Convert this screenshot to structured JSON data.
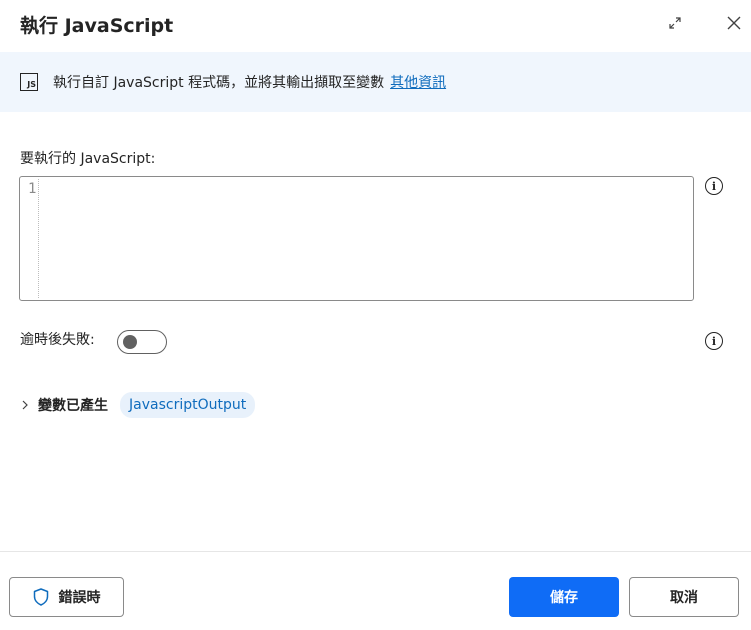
{
  "dialog": {
    "title": "執行 JavaScript",
    "expand_icon": "expand-icon",
    "close_icon": "close-icon"
  },
  "banner": {
    "icon": "js-file-icon",
    "icon_text": "JS",
    "text": "執行自訂 JavaScript 程式碼，並將其輸出擷取至變數",
    "link": "其他資訊"
  },
  "script_field": {
    "label": "要執行的 JavaScript:",
    "line_number": "1",
    "value": ""
  },
  "timeout": {
    "label": "逾時後失敗:",
    "enabled": false
  },
  "variables": {
    "label": "變數已產生",
    "chip": "JavascriptOutput"
  },
  "footer": {
    "error_button": "錯誤時",
    "save_button": "儲存",
    "cancel_button": "取消"
  },
  "colors": {
    "accent": "#0f6cf6",
    "link": "#0f6cbd",
    "banner_bg": "#f0f6fd"
  }
}
